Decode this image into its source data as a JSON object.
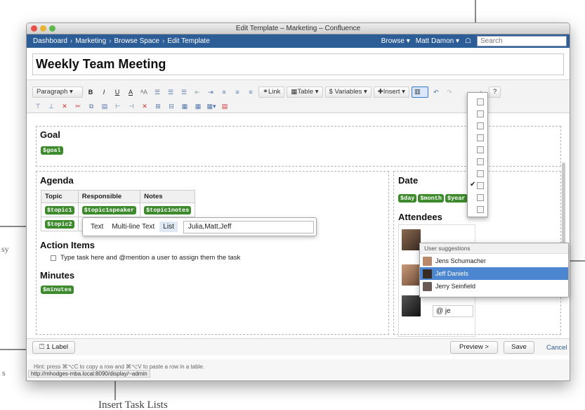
{
  "window": {
    "title": "Edit Template – Marketing – Confluence"
  },
  "nav": {
    "breadcrumbs": [
      "Dashboard",
      "Marketing",
      "Browse Space",
      "Edit Template"
    ],
    "browse": "Browse ▾",
    "user": "Matt Damon ▾",
    "search_placeholder": "Search"
  },
  "page_title": "Weekly Team Meeting",
  "toolbar": {
    "paragraph": "Paragraph",
    "link": "Link",
    "table": "Table",
    "variables": "$ Variables",
    "insert": "Insert"
  },
  "goal": {
    "title": "Goal",
    "var": "$goal"
  },
  "agenda": {
    "title": "Agenda",
    "headers": [
      "Topic",
      "Responsible",
      "Notes"
    ],
    "rows": [
      [
        "$topic1",
        "$topic1speaker",
        "$topic1notes"
      ],
      [
        "$topic2",
        "",
        ""
      ]
    ]
  },
  "popover": {
    "options": [
      "Text",
      "Multi-line Text",
      "List"
    ],
    "value": "Julia,Matt,Jeff"
  },
  "action_items": {
    "title": "Action Items",
    "task": "Type task here and @mention a user to assign them the task"
  },
  "minutes": {
    "title": "Minutes",
    "var": "$minutes"
  },
  "date": {
    "title": "Date",
    "vars": [
      "$day",
      "$month",
      "$year"
    ]
  },
  "attendees": {
    "title": "Attendees",
    "mention": "@ je"
  },
  "suggestions": {
    "title": "User suggestions",
    "users": [
      "Jens Schumacher",
      "Jeff Daniels",
      "Jerry Seinfield"
    ],
    "selected": 1
  },
  "footer": {
    "label": "1 Label",
    "preview": "Preview >",
    "save": "Save",
    "cancel": "Cancel",
    "hint": "Hint: press ⌘⌥C to copy a row and ⌘⌥V to paste a row in a table.",
    "status_url": "http://mhodges-mba.local:8090/display/~admin"
  },
  "annotations": {
    "insert_task_lists": "Insert Task Lists",
    "left_fragment": "sy",
    "left_fragment2": "s"
  },
  "colors": {
    "nav_bg": "#2d5d97",
    "variable": "#3d8a2d",
    "selected": "#4c86d0"
  }
}
